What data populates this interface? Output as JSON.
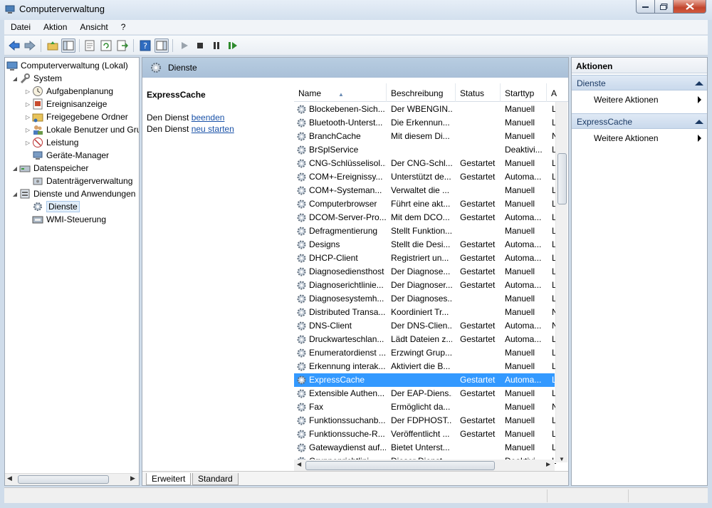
{
  "window": {
    "title": "Computerverwaltung"
  },
  "menubar": [
    "Datei",
    "Aktion",
    "Ansicht",
    "?"
  ],
  "tree": [
    {
      "label": "Computerverwaltung (Lokal)",
      "icon": "computer-management-icon",
      "level": 0
    },
    {
      "label": "System",
      "icon": "tools-icon",
      "level": 1,
      "expanded": true
    },
    {
      "label": "Aufgabenplanung",
      "icon": "clock-icon",
      "level": 2
    },
    {
      "label": "Ereignisanzeige",
      "icon": "event-viewer-icon",
      "level": 2
    },
    {
      "label": "Freigegebene Ordner",
      "icon": "shared-folder-icon",
      "level": 2
    },
    {
      "label": "Lokale Benutzer und Gruppen",
      "icon": "users-icon",
      "level": 2
    },
    {
      "label": "Leistung",
      "icon": "performance-icon",
      "level": 2
    },
    {
      "label": "Geräte-Manager",
      "icon": "device-manager-icon",
      "level": 2
    },
    {
      "label": "Datenspeicher",
      "icon": "storage-icon",
      "level": 1,
      "expanded": true
    },
    {
      "label": "Datenträgerverwaltung",
      "icon": "disk-icon",
      "level": 2
    },
    {
      "label": "Dienste und Anwendungen",
      "icon": "services-apps-icon",
      "level": 1,
      "expanded": true
    },
    {
      "label": "Dienste",
      "icon": "gear-icon",
      "level": 2,
      "selected": true
    },
    {
      "label": "WMI-Steuerung",
      "icon": "wmi-icon",
      "level": 2
    }
  ],
  "middle": {
    "header_title": "Dienste",
    "detail": {
      "service_name": "ExpressCache",
      "line1_prefix": "Den Dienst ",
      "line1_link": "beenden",
      "line2_prefix": "Den Dienst ",
      "line2_link": "neu starten"
    },
    "columns": [
      "Name",
      "Beschreibung",
      "Status",
      "Starttyp",
      "A"
    ],
    "rows": [
      {
        "name": "Blockebenen-Sich...",
        "desc": "Der WBENGIN...",
        "status": "",
        "start": "Manuell",
        "a": "L"
      },
      {
        "name": "Bluetooth-Unterst...",
        "desc": "Die Erkennun...",
        "status": "",
        "start": "Manuell",
        "a": "L"
      },
      {
        "name": "BranchCache",
        "desc": "Mit diesem Di...",
        "status": "",
        "start": "Manuell",
        "a": "N"
      },
      {
        "name": "BrSplService",
        "desc": "",
        "status": "",
        "start": "Deaktivi...",
        "a": "L"
      },
      {
        "name": "CNG-Schlüsselisol...",
        "desc": "Der CNG-Schl...",
        "status": "Gestartet",
        "start": "Manuell",
        "a": "L"
      },
      {
        "name": "COM+-Ereignissy...",
        "desc": "Unterstützt de...",
        "status": "Gestartet",
        "start": "Automa...",
        "a": "L"
      },
      {
        "name": "COM+-Systeman...",
        "desc": "Verwaltet die ...",
        "status": "",
        "start": "Manuell",
        "a": "L"
      },
      {
        "name": "Computerbrowser",
        "desc": "Führt eine akt...",
        "status": "Gestartet",
        "start": "Manuell",
        "a": "L"
      },
      {
        "name": "DCOM-Server-Pro...",
        "desc": "Mit dem DCO...",
        "status": "Gestartet",
        "start": "Automa...",
        "a": "L"
      },
      {
        "name": "Defragmentierung",
        "desc": "Stellt Funktion...",
        "status": "",
        "start": "Manuell",
        "a": "L"
      },
      {
        "name": "Designs",
        "desc": "Stellt die Desi...",
        "status": "Gestartet",
        "start": "Automa...",
        "a": "L"
      },
      {
        "name": "DHCP-Client",
        "desc": "Registriert un...",
        "status": "Gestartet",
        "start": "Automa...",
        "a": "L"
      },
      {
        "name": "Diagnosediensthost",
        "desc": "Der Diagnose...",
        "status": "Gestartet",
        "start": "Manuell",
        "a": "L"
      },
      {
        "name": "Diagnoserichtlinie...",
        "desc": "Der Diagnoser...",
        "status": "Gestartet",
        "start": "Automa...",
        "a": "L"
      },
      {
        "name": "Diagnosesystemh...",
        "desc": "Der Diagnoses...",
        "status": "",
        "start": "Manuell",
        "a": "L"
      },
      {
        "name": "Distributed Transa...",
        "desc": "Koordiniert Tr...",
        "status": "",
        "start": "Manuell",
        "a": "N"
      },
      {
        "name": "DNS-Client",
        "desc": "Der DNS-Clien...",
        "status": "Gestartet",
        "start": "Automa...",
        "a": "N"
      },
      {
        "name": "Druckwarteschlan...",
        "desc": "Lädt Dateien z...",
        "status": "Gestartet",
        "start": "Automa...",
        "a": "L"
      },
      {
        "name": "Enumeratordienst ...",
        "desc": "Erzwingt Grup...",
        "status": "",
        "start": "Manuell",
        "a": "L"
      },
      {
        "name": "Erkennung interak...",
        "desc": "Aktiviert die B...",
        "status": "",
        "start": "Manuell",
        "a": "L"
      },
      {
        "name": "ExpressCache",
        "desc": "",
        "status": "Gestartet",
        "start": "Automa...",
        "a": "L",
        "selected": true
      },
      {
        "name": "Extensible Authen...",
        "desc": "Der EAP-Diens...",
        "status": "Gestartet",
        "start": "Manuell",
        "a": "L"
      },
      {
        "name": "Fax",
        "desc": "Ermöglicht da...",
        "status": "",
        "start": "Manuell",
        "a": "N"
      },
      {
        "name": "Funktionssuchanb...",
        "desc": "Der FDPHOST...",
        "status": "Gestartet",
        "start": "Manuell",
        "a": "L"
      },
      {
        "name": "Funktionssuche-R...",
        "desc": "Veröffentlicht ...",
        "status": "Gestartet",
        "start": "Manuell",
        "a": "L"
      },
      {
        "name": "Gatewaydienst auf...",
        "desc": "Bietet Unterst...",
        "status": "",
        "start": "Manuell",
        "a": "L"
      },
      {
        "name": "Gruppenrichtlini...",
        "desc": "Dieser Dienst ...",
        "status": "",
        "start": "Deaktivi...",
        "a": "L"
      }
    ],
    "tabs": [
      "Erweitert",
      "Standard"
    ]
  },
  "actions": {
    "title": "Aktionen",
    "groups": [
      {
        "label": "Dienste",
        "items": [
          "Weitere Aktionen"
        ]
      },
      {
        "label": "ExpressCache",
        "items": [
          "Weitere Aktionen"
        ]
      }
    ]
  },
  "colors": {
    "selection": "#3399ff",
    "link": "#1a52a8",
    "header_band": "#b1c7dd"
  }
}
